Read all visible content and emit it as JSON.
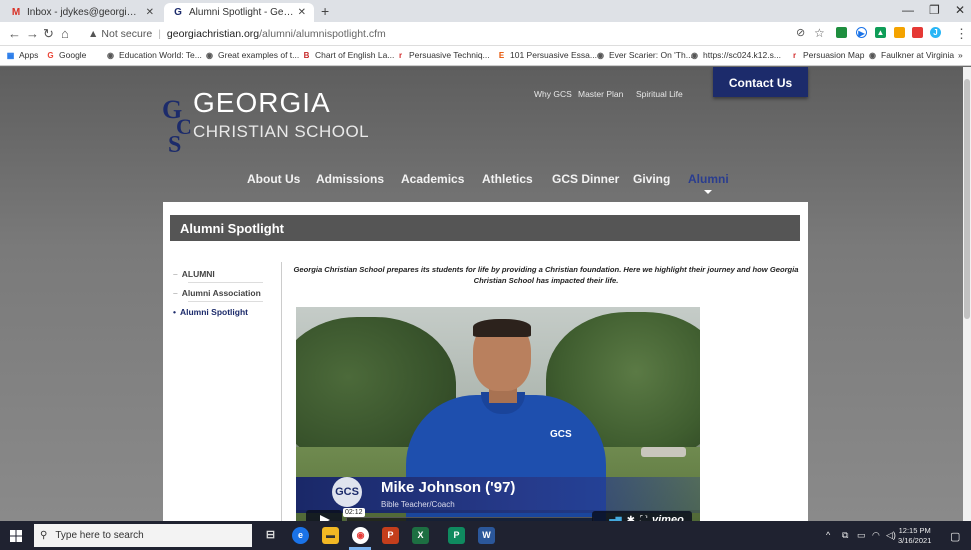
{
  "browser": {
    "tabs": [
      {
        "label": "Inbox - jdykes@georgiachristian",
        "favicon": "M",
        "color": "#d93025"
      },
      {
        "label": "Alumni Spotlight - Georgia Chris",
        "favicon": "GCS",
        "color": "#1c2b6b"
      }
    ],
    "address": {
      "not_secure": "Not secure",
      "host": "georgiachristian.org",
      "path": "/alumni/alumnispotlight.cfm"
    },
    "bookmarks": [
      "Apps",
      "Google",
      "Education World: Te...",
      "Great examples of t...",
      "Chart of English La...",
      "Persuasive Techniq...",
      "101 Persuasive Essa...",
      "Ever Scarier: On 'Th...",
      "https://sc024.k12.s...",
      "Persuasion Map",
      "Faulkner at Virginia"
    ],
    "more_bookmarks": "»"
  },
  "site": {
    "logo_title": "GEORGIA",
    "logo_subtitle": "CHRISTIAN SCHOOL",
    "top_links": [
      "Why GCS",
      "Master Plan",
      "Spiritual Life"
    ],
    "contact": "Contact Us",
    "nav": [
      "About Us",
      "Admissions",
      "Academics",
      "Athletics",
      "GCS Dinner",
      "Giving",
      "Alumni"
    ],
    "active_nav": "Alumni",
    "page_title": "Alumni Spotlight",
    "sidebar": [
      {
        "label": "ALUMNI",
        "active": false
      },
      {
        "label": "Alumni Association",
        "active": false
      },
      {
        "label": "Alumni Spotlight",
        "active": true
      }
    ],
    "intro": "Georgia Christian School prepares its students for life by providing a Christian foundation.  Here we highlight their journey and how Georgia Christian School has impacted their life.",
    "video": {
      "name": "Mike Johnson ('97)",
      "role": "Bible Teacher/Coach",
      "badge": "GCS",
      "timecode": "02:12",
      "brand": "vimeo",
      "shirt_logo": "GCS"
    }
  },
  "taskbar": {
    "search_placeholder": "Type here to search",
    "time": "12:15 PM",
    "date": "3/16/2021"
  }
}
